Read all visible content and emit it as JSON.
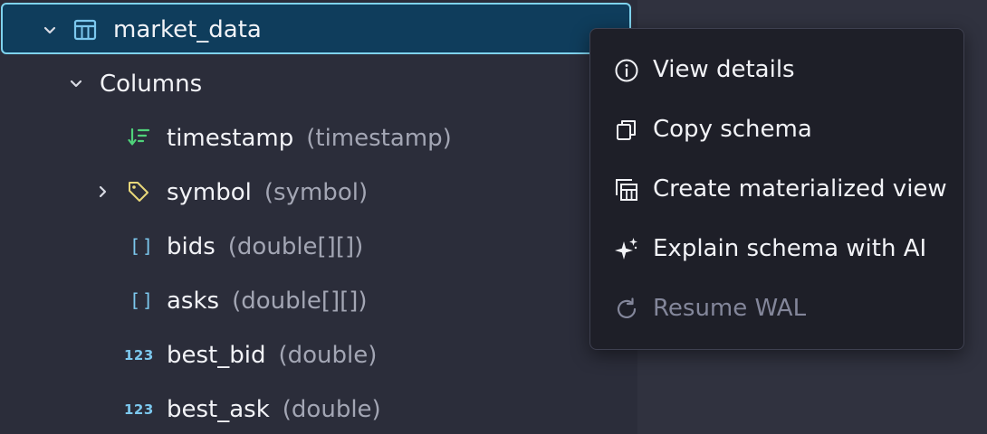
{
  "tree": {
    "table": {
      "name": "market_data",
      "expanded": true,
      "icon": "table-icon"
    },
    "columns_group": {
      "label": "Columns",
      "expanded": true
    },
    "columns": [
      {
        "name": "timestamp",
        "type": "(timestamp)",
        "icon": "designated-timestamp-icon",
        "expandable": false
      },
      {
        "name": "symbol",
        "type": "(symbol)",
        "icon": "tag-icon",
        "expandable": true
      },
      {
        "name": "bids",
        "type": "(double[][])",
        "icon": "array-icon",
        "icon_text": "[]",
        "expandable": false
      },
      {
        "name": "asks",
        "type": "(double[][])",
        "icon": "array-icon",
        "icon_text": "[]",
        "expandable": false
      },
      {
        "name": "best_bid",
        "type": "(double)",
        "icon": "number-icon",
        "icon_text": "123",
        "expandable": false
      },
      {
        "name": "best_ask",
        "type": "(double)",
        "icon": "number-icon",
        "icon_text": "123",
        "expandable": false
      }
    ]
  },
  "context_menu": {
    "items": [
      {
        "label": "View details",
        "icon": "info-icon",
        "disabled": false
      },
      {
        "label": "Copy schema",
        "icon": "copy-icon",
        "disabled": false
      },
      {
        "label": "Create materialized view",
        "icon": "materialized-view-icon",
        "disabled": false
      },
      {
        "label": "Explain schema with AI",
        "icon": "sparkle-icon",
        "disabled": false
      },
      {
        "label": "Resume WAL",
        "icon": "refresh-icon",
        "disabled": true
      }
    ]
  },
  "colors": {
    "selected_row_bg": "#0f3d5c",
    "selected_row_border": "#7fd3ee",
    "timestamp_icon": "#4fd27a",
    "tag_icon": "#e8d77a",
    "type_icon": "#7cc8ee",
    "type_text": "#a3a6b4",
    "menu_bg": "#1e1f28",
    "disabled_text": "#83869a"
  }
}
